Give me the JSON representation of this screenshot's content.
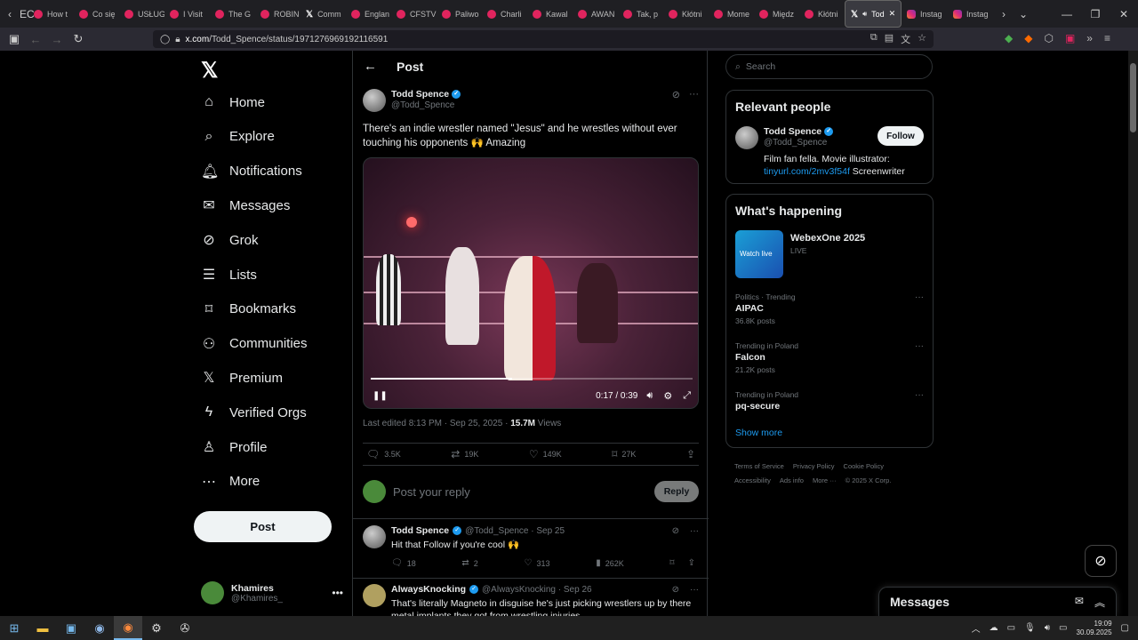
{
  "browser": {
    "tabs": [
      {
        "label": "EC",
        "icon": "chevron"
      },
      {
        "label": "How t",
        "icon": "youtube"
      },
      {
        "label": "Co się",
        "icon": "youtube"
      },
      {
        "label": "USŁUG",
        "icon": "youtube"
      },
      {
        "label": "I Visit",
        "icon": "youtube"
      },
      {
        "label": "The G",
        "icon": "youtube"
      },
      {
        "label": "ROBIN",
        "icon": "youtube"
      },
      {
        "label": "Comm",
        "icon": "x"
      },
      {
        "label": "Englan",
        "icon": "youtube"
      },
      {
        "label": "CFSTV",
        "icon": "youtube"
      },
      {
        "label": "Paliwo",
        "icon": "youtube"
      },
      {
        "label": "Charli",
        "icon": "youtube"
      },
      {
        "label": "Kawal",
        "icon": "youtube"
      },
      {
        "label": "AWAN",
        "icon": "youtube"
      },
      {
        "label": "Tak, p",
        "icon": "youtube"
      },
      {
        "label": "Kłótni",
        "icon": "youtube"
      },
      {
        "label": "Mome",
        "icon": "youtube"
      },
      {
        "label": "Międz",
        "icon": "youtube"
      },
      {
        "label": "Kłótni",
        "icon": "youtube"
      }
    ],
    "active_tab": "Tod",
    "extra_tabs": [
      "Instag",
      "Instag"
    ],
    "url_domain": "x.com",
    "url_path": "/Todd_Spence/status/1971276969192116591"
  },
  "nav": {
    "items": [
      {
        "label": "Home",
        "icon": "home-icon"
      },
      {
        "label": "Explore",
        "icon": "search-icon"
      },
      {
        "label": "Notifications",
        "icon": "bell-icon"
      },
      {
        "label": "Messages",
        "icon": "mail-icon"
      },
      {
        "label": "Grok",
        "icon": "grok-icon"
      },
      {
        "label": "Lists",
        "icon": "list-icon"
      },
      {
        "label": "Bookmarks",
        "icon": "bookmark-icon"
      },
      {
        "label": "Communities",
        "icon": "people-icon"
      },
      {
        "label": "Premium",
        "icon": "x-icon"
      },
      {
        "label": "Verified Orgs",
        "icon": "bolt-icon"
      },
      {
        "label": "Profile",
        "icon": "person-icon"
      },
      {
        "label": "More",
        "icon": "more-circle-icon"
      }
    ],
    "post_button": "Post",
    "account": {
      "name": "Khamires",
      "handle": "@Khamires_"
    }
  },
  "post": {
    "header_title": "Post",
    "author_name": "Todd Spence",
    "author_handle": "@Todd_Spence",
    "text": "There's an indie wrestler named \"Jesus\" and he wrestles without ever touching his opponents 🙌 Amazing",
    "video_time": "0:17 / 0:39",
    "video_progress": 0.44,
    "meta_edited": "Last edited 8:13 PM · Sep 25, 2025 · ",
    "meta_views_count": "15.7M",
    "meta_views_label": " Views",
    "stats": {
      "replies": "3.5K",
      "reposts": "19K",
      "likes": "149K",
      "bookmarks": "27K"
    },
    "reply_placeholder": "Post your reply",
    "reply_button": "Reply"
  },
  "replies": [
    {
      "name": "Todd Spence",
      "handle_date": "@Todd_Spence · Sep 25",
      "text": "Hit that Follow if you're cool 🙌",
      "replies": "18",
      "reposts": "2",
      "likes": "313",
      "views": "262K"
    },
    {
      "name": "AlwaysKnocking",
      "handle_date": "@AlwaysKnocking · Sep 26",
      "text": "That's literally Magneto in disguise he's just picking wrestlers up by there metal implants they got from wrestling injuries"
    }
  ],
  "sidebar": {
    "search_placeholder": "Search",
    "relevant_title": "Relevant people",
    "person": {
      "name": "Todd Spence",
      "handle": "@Todd_Spence",
      "follow": "Follow",
      "bio_text": "Film fan fella. Movie illustrator:",
      "bio_link": "tinyurl.com/2mv3f54f",
      "bio_suffix": " Screenwriter"
    },
    "happening_title": "What's happening",
    "event": {
      "title": "WebexOne 2025",
      "status": "LIVE",
      "thumb_text": "Watch live"
    },
    "trends": [
      {
        "context": "Politics · Trending",
        "name": "AIPAC",
        "count": "36.8K posts"
      },
      {
        "context": "Trending in Poland",
        "name": "Falcon",
        "count": "21.2K posts"
      },
      {
        "context": "Trending in Poland",
        "name": "pq-secure",
        "count": ""
      }
    ],
    "show_more": "Show more",
    "footer_links": [
      "Terms of Service",
      "Privacy Policy",
      "Cookie Policy",
      "Accessibility",
      "Ads info",
      "More ···",
      "© 2025 X Corp."
    ]
  },
  "messages_drawer": {
    "title": "Messages"
  },
  "taskbar": {
    "time": "19:09",
    "date": "30.09.2025"
  }
}
